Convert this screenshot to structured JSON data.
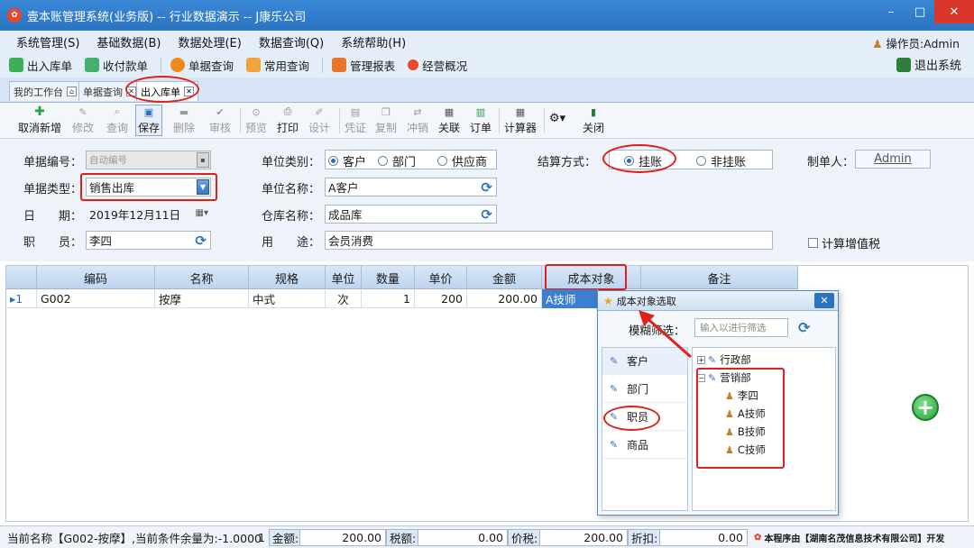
{
  "window": {
    "title": "壹本账管理系统(业务版) -- 行业数据演示 -- J康乐公司",
    "min": "–",
    "max": "□",
    "close": "✕"
  },
  "menu": {
    "items": [
      "系统管理(S)",
      "基础数据(B)",
      "数据处理(E)",
      "数据查询(Q)",
      "系统帮助(H)"
    ],
    "operator": "操作员:Admin"
  },
  "quick": {
    "items": [
      "出入库单",
      "收付款单",
      "单据查询",
      "常用查询",
      "管理报表",
      "经营概况"
    ],
    "exit": "退出系统"
  },
  "tabs": [
    {
      "label": "我的工作台"
    },
    {
      "label": "单据查询"
    },
    {
      "label": "出入库单"
    }
  ],
  "toolbar": {
    "items": [
      "取消新增",
      "修改",
      "查询",
      "保存",
      "删除",
      "审核",
      "预览",
      "打印",
      "设计",
      "凭证",
      "复制",
      "冲销",
      "关联",
      "订单",
      "计算器",
      "关闭"
    ]
  },
  "form": {
    "doc_no_label": "单据编号：",
    "doc_no_value": "自动编号",
    "doc_type_label": "单据类型：",
    "doc_type_value": "销售出库",
    "date_label": "日　　期：",
    "date_value": "2019年12月11日",
    "staff_label": "职　　员：",
    "staff_value": "李四",
    "unit_type_label": "单位类别：",
    "unit_types": [
      "客户",
      "部门",
      "供应商"
    ],
    "unit_name_label": "单位名称：",
    "unit_name_value": "A客户",
    "warehouse_label": "仓库名称：",
    "warehouse_value": "成品库",
    "purpose_label": "用　　途：",
    "purpose_value": "会员消费",
    "settle_label": "结算方式：",
    "settle_options": [
      "挂账",
      "非挂账"
    ],
    "maker_label": "制单人：",
    "maker_value": "Admin",
    "vat_label": "计算增值税"
  },
  "grid": {
    "headers": [
      "编码",
      "名称",
      "规格",
      "单位",
      "数量",
      "单价",
      "金额",
      "成本对象",
      "备注"
    ],
    "rows": [
      {
        "index": "1",
        "code": "G002",
        "name": "按摩",
        "spec": "中式",
        "unit": "次",
        "qty": "1",
        "price": "200",
        "amount": "200.00",
        "cost": "A技师",
        "note": ""
      }
    ]
  },
  "popup": {
    "title": "成本对象选取",
    "close": "✕",
    "filter_label": "模糊筛选：",
    "filter_placeholder": "输入以进行筛选",
    "categories": [
      "客户",
      "部门",
      "职员",
      "商品"
    ],
    "tree": {
      "dept1": "行政部",
      "dept2": "营销部",
      "members": [
        "李四",
        "A技师",
        "B技师",
        "C技师"
      ]
    }
  },
  "status": {
    "current": "当前名称【G002-按摩】,当前条件余量为:-1.0000",
    "count": "1",
    "amount_label": "金额:",
    "amount": "200.00",
    "tax_label": "税额:",
    "tax": "0.00",
    "price_tax_label": "价税:",
    "price_tax": "200.00",
    "discount_label": "折扣:",
    "discount": "0.00",
    "vendor": "本程序由【湖南名茂信息技术有限公司】开发"
  },
  "colors": {
    "title": "#2b74c2",
    "highlight": "#e0201a",
    "selected": "#3c7fd0"
  }
}
